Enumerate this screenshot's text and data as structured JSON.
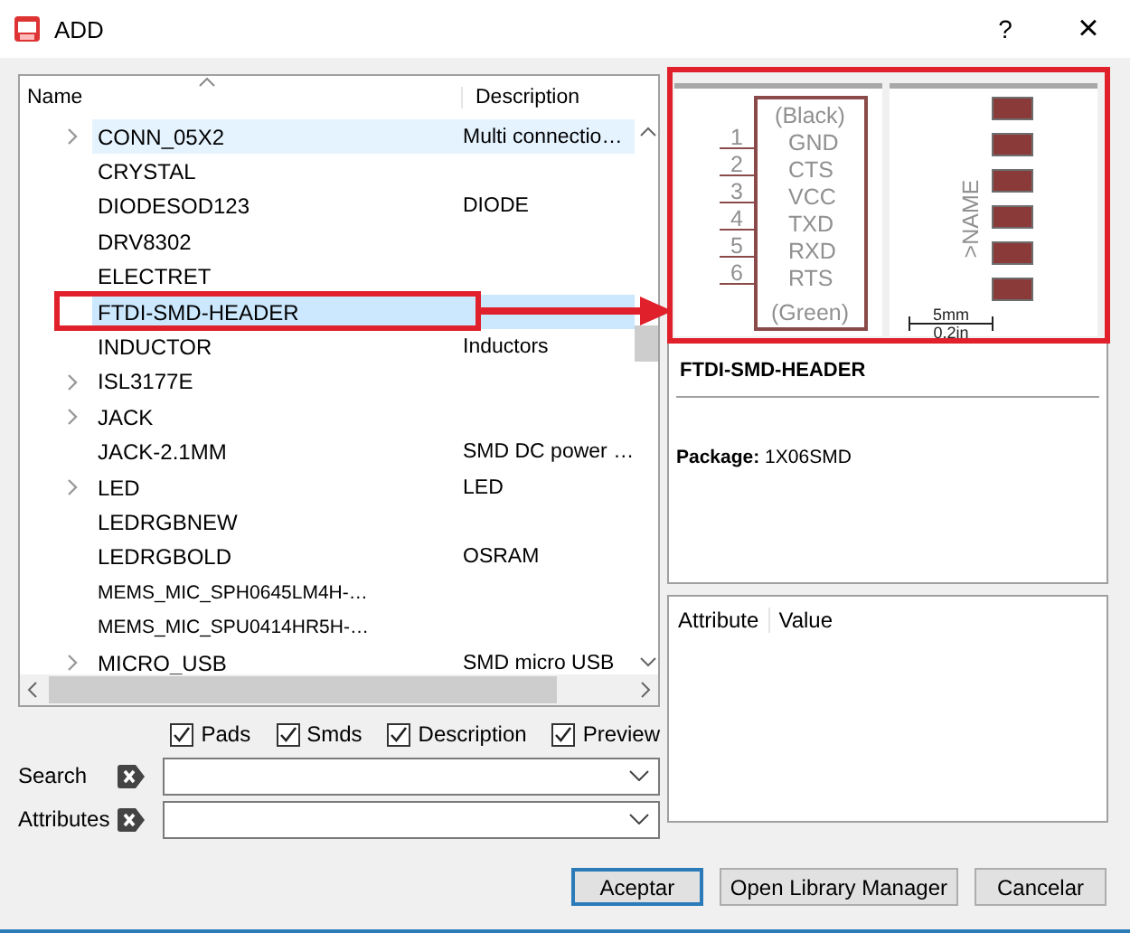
{
  "window": {
    "title": "ADD",
    "help": "?",
    "close": "×"
  },
  "list": {
    "columns": [
      "Name",
      "Description"
    ],
    "rows": [
      {
        "name": "CONN_05X2",
        "description": "Multi connectio…",
        "expandable": true,
        "selected": false,
        "hovered": true
      },
      {
        "name": "CRYSTAL",
        "description": "",
        "expandable": false,
        "selected": false,
        "hovered": false
      },
      {
        "name": "DIODESOD123",
        "description": "DIODE",
        "expandable": false,
        "selected": false,
        "hovered": false
      },
      {
        "name": "DRV8302",
        "description": "",
        "expandable": false,
        "selected": false,
        "hovered": false
      },
      {
        "name": "ELECTRET",
        "description": "",
        "expandable": false,
        "selected": false,
        "hovered": false
      },
      {
        "name": "FTDI-SMD-HEADER",
        "description": "",
        "expandable": false,
        "selected": true,
        "hovered": false
      },
      {
        "name": "INDUCTOR",
        "description": "Inductors",
        "expandable": false,
        "selected": false,
        "hovered": false
      },
      {
        "name": "ISL3177E",
        "description": "",
        "expandable": true,
        "selected": false,
        "hovered": false
      },
      {
        "name": "JACK",
        "description": "",
        "expandable": true,
        "selected": false,
        "hovered": false
      },
      {
        "name": "JACK-2.1MM",
        "description": "SMD DC power …",
        "expandable": false,
        "selected": false,
        "hovered": false
      },
      {
        "name": "LED",
        "description": "LED",
        "expandable": true,
        "selected": false,
        "hovered": false
      },
      {
        "name": "LEDRGBNEW",
        "description": "",
        "expandable": false,
        "selected": false,
        "hovered": false
      },
      {
        "name": "LEDRGBOLD",
        "description": "OSRAM",
        "expandable": false,
        "selected": false,
        "hovered": false
      },
      {
        "name": "MEMS_MIC_SPH0645LM4H-…",
        "description": "",
        "expandable": false,
        "selected": false,
        "hovered": false
      },
      {
        "name": "MEMS_MIC_SPU0414HR5H-…",
        "description": "",
        "expandable": false,
        "selected": false,
        "hovered": false
      },
      {
        "name": "MICRO_USB",
        "description": "SMD micro USB",
        "expandable": true,
        "selected": false,
        "hovered": false
      }
    ]
  },
  "options": [
    {
      "label": "Pads",
      "checked": true
    },
    {
      "label": "Smds",
      "checked": true
    },
    {
      "label": "Description",
      "checked": true
    },
    {
      "label": "Preview",
      "checked": true
    }
  ],
  "filters": [
    {
      "label": "Search"
    },
    {
      "label": "Attributes"
    }
  ],
  "preview": {
    "symbol": {
      "top_label": "(Black)",
      "bottom_label": "(Green)",
      "pins": [
        {
          "number": "1",
          "name": "GND"
        },
        {
          "number": "2",
          "name": "CTS"
        },
        {
          "number": "3",
          "name": "VCC"
        },
        {
          "number": "4",
          "name": "TXD"
        },
        {
          "number": "5",
          "name": "RXD"
        },
        {
          "number": "6",
          "name": "RTS"
        }
      ]
    },
    "package": {
      "name_label": ">NAME",
      "scale_top": "5mm",
      "scale_bottom": "0.2in"
    }
  },
  "description": {
    "title": "FTDI-SMD-HEADER",
    "text": "**Package:** 1X06SMD"
  },
  "attributes": {
    "columns": [
      "Attribute",
      "Value"
    ]
  },
  "buttons": [
    {
      "label": "Aceptar",
      "default": true
    },
    {
      "label": "Open Library Manager",
      "default": false
    },
    {
      "label": "Cancelar",
      "default": false
    }
  ]
}
